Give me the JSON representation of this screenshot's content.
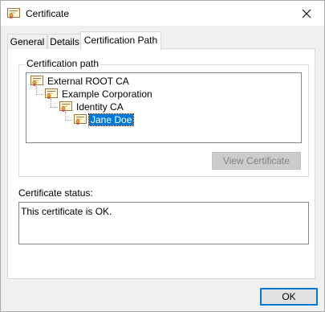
{
  "window": {
    "title": "Certificate",
    "close_icon": "close-icon"
  },
  "tabs": [
    {
      "label": "General",
      "active": false
    },
    {
      "label": "Details",
      "active": false
    },
    {
      "label": "Certification Path",
      "active": true
    }
  ],
  "certification_path": {
    "group_label": "Certification path",
    "nodes": [
      {
        "label": "External ROOT CA",
        "level": 0,
        "selected": false
      },
      {
        "label": "Example Corporation",
        "level": 1,
        "selected": false
      },
      {
        "label": "Identity CA",
        "level": 2,
        "selected": false
      },
      {
        "label": "Jane Doe",
        "level": 3,
        "selected": true
      }
    ],
    "view_certificate_label": "View Certificate",
    "view_certificate_enabled": false
  },
  "status": {
    "label": "Certificate status:",
    "text": "This certificate is OK."
  },
  "footer": {
    "ok_label": "OK"
  },
  "colors": {
    "selection": "#0078d7",
    "cert_ribbon": "#e8a33a"
  }
}
